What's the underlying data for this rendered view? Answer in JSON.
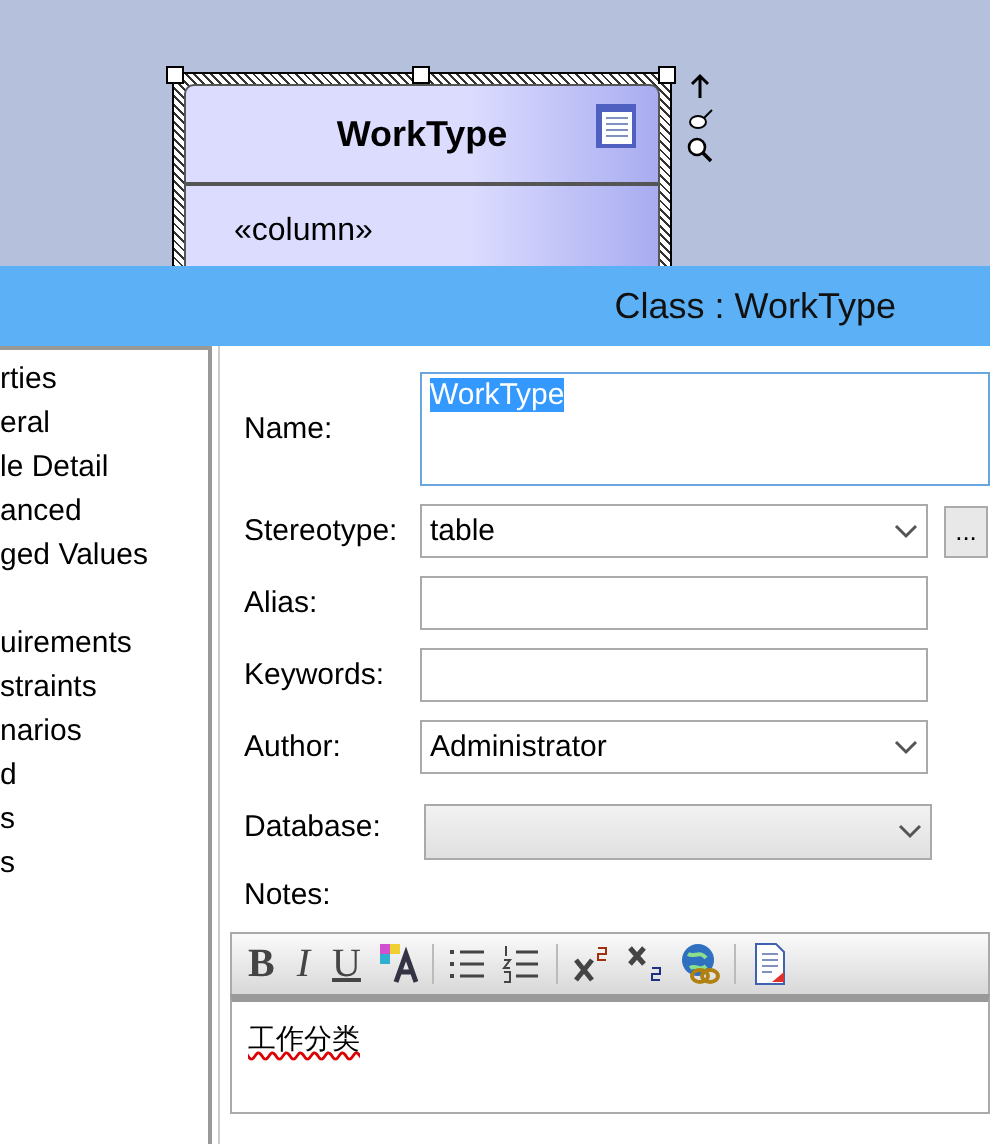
{
  "diagram": {
    "class_name": "WorkType",
    "stereotype": "«column»"
  },
  "dialog": {
    "title": "Class : WorkType"
  },
  "tree": {
    "groups": [
      [
        "rties",
        "eral",
        "le Detail",
        "anced",
        "ged Values"
      ],
      [
        "uirements",
        "straints",
        "narios",
        "d",
        "s",
        "s"
      ]
    ]
  },
  "form": {
    "fields": [
      {
        "kind": "textarea",
        "label": "Name:",
        "value": "WorkType",
        "selected": true
      },
      {
        "kind": "select",
        "label": "Stereotype:",
        "value": "table",
        "button": "..."
      },
      {
        "kind": "text",
        "label": "Alias:"
      },
      {
        "kind": "text",
        "label": "Keywords:"
      },
      {
        "kind": "select",
        "label": "Author:",
        "value": "Administrator"
      },
      {
        "kind": "select",
        "label": "Database:",
        "disabled": true
      }
    ]
  },
  "notes": {
    "label": "Notes:",
    "toolbar": [
      {
        "kind": "bold",
        "glyph": "B"
      },
      {
        "kind": "italic",
        "glyph": "I"
      },
      {
        "kind": "underline",
        "glyph": "U"
      },
      {
        "kind": "font"
      },
      {
        "kind": "sep"
      },
      {
        "kind": "bullets"
      },
      {
        "kind": "numbers"
      },
      {
        "kind": "sep"
      },
      {
        "kind": "sup"
      },
      {
        "kind": "sub"
      },
      {
        "kind": "link"
      },
      {
        "kind": "sep"
      },
      {
        "kind": "doc"
      }
    ],
    "text": "工作分类"
  }
}
